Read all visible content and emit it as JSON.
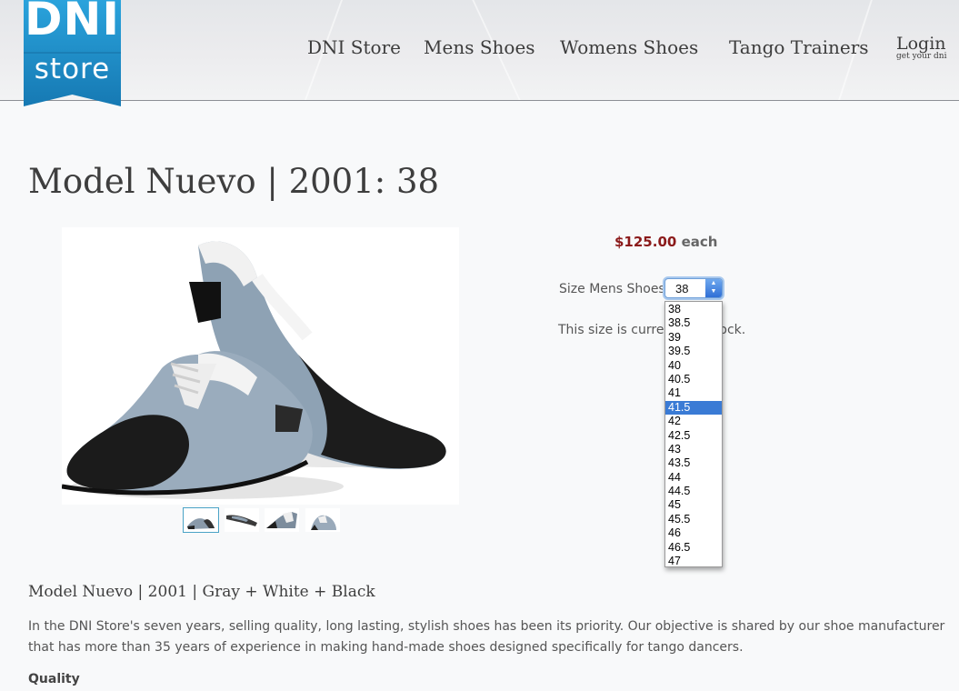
{
  "header": {
    "logo": {
      "line1": "DNI",
      "line2": "store",
      "color": "#1f8fc9"
    },
    "nav": [
      {
        "label": "DNI Store"
      },
      {
        "label": "Mens Shoes"
      },
      {
        "label": "Womens Shoes"
      },
      {
        "label": "Tango Trainers"
      }
    ],
    "login": {
      "label": "Login",
      "sublabel": "get your dni"
    }
  },
  "product": {
    "title": "Model Nuevo | 2001: 38",
    "price": "$125.00",
    "price_unit": "each",
    "size_label": "Size Mens Shoes",
    "size_selected": "38",
    "stock_message": "This size is currently in stock.",
    "image": {
      "subject": "gray-white-black-oxford-tango-shoes"
    },
    "thumbnails": [
      {
        "name": "pair-view",
        "selected": true
      },
      {
        "name": "side-view",
        "selected": false
      },
      {
        "name": "back-view",
        "selected": false
      },
      {
        "name": "front-view",
        "selected": false
      }
    ]
  },
  "size_dropdown": {
    "options": [
      "38",
      "38.5",
      "39",
      "39.5",
      "40",
      "40.5",
      "41",
      "41.5",
      "42",
      "42.5",
      "43",
      "43.5",
      "44",
      "44.5",
      "45",
      "45.5",
      "46",
      "46.5",
      "47"
    ],
    "highlighted": "41.5"
  },
  "description": {
    "title": "Model Nuevo | 2001 | Gray + White + Black",
    "body": "In the DNI Store's seven years, selling quality, long lasting, stylish shoes has been its priority. Our objective is shared by our shoe manufacturer that has more than 35 years of experience in making hand-made shoes designed specifically for tango dancers.",
    "section_heading": "Quality"
  },
  "colors": {
    "price": "#8b1a1a",
    "dropdown_highlight": "#3a7bd5",
    "logo_blue": "#1f8fc9"
  }
}
